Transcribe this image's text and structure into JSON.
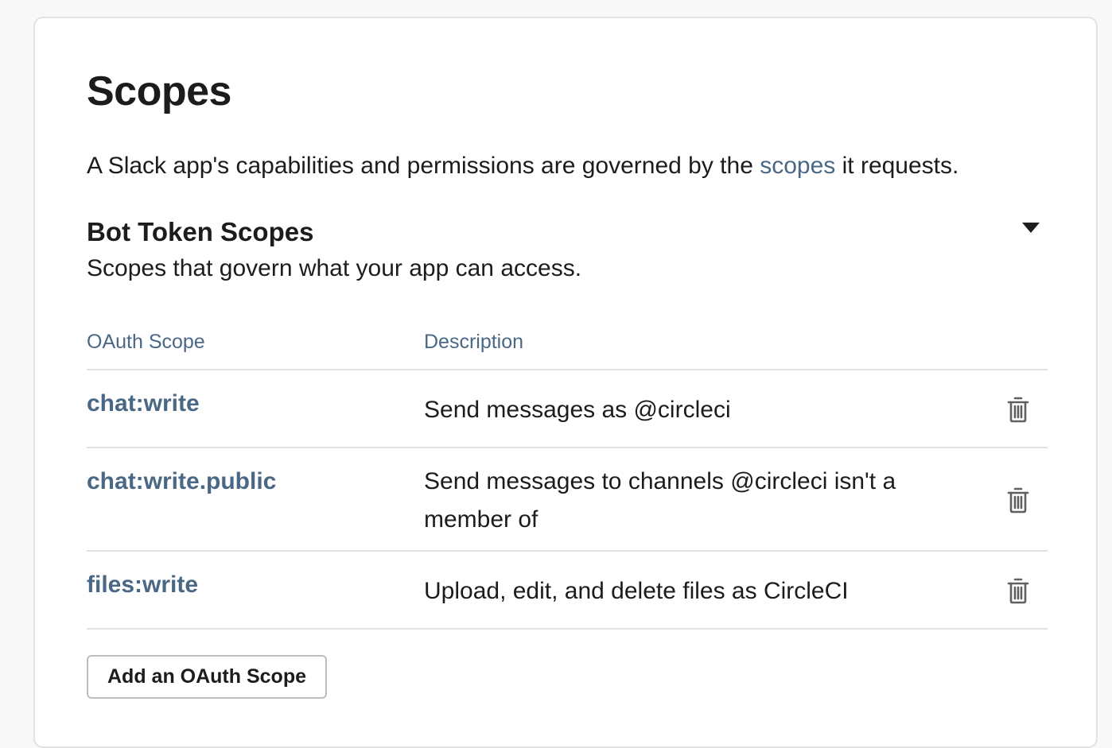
{
  "section": {
    "title": "Scopes",
    "intro_before": "A Slack app's capabilities and permissions are governed by the ",
    "intro_link": "scopes",
    "intro_after": " it requests."
  },
  "bot_token": {
    "title": "Bot Token Scopes",
    "subtitle": "Scopes that govern what your app can access.",
    "caret_icon": "caret-down-icon"
  },
  "table": {
    "headers": {
      "scope": "OAuth Scope",
      "description": "Description"
    },
    "rows": [
      {
        "scope": "chat:write",
        "description": "Send messages as @circleci",
        "action_icon": "trash-icon"
      },
      {
        "scope": "chat:write.public",
        "description": "Send messages to channels @circleci isn't a member of",
        "action_icon": "trash-icon"
      },
      {
        "scope": "files:write",
        "description": "Upload, edit, and delete files as CircleCI",
        "action_icon": "trash-icon"
      }
    ]
  },
  "actions": {
    "add_scope_label": "Add an OAuth Scope"
  },
  "colors": {
    "link": "#4a6886",
    "text": "#1d1c1d",
    "border": "#e2e2e2",
    "icon": "#616061"
  }
}
